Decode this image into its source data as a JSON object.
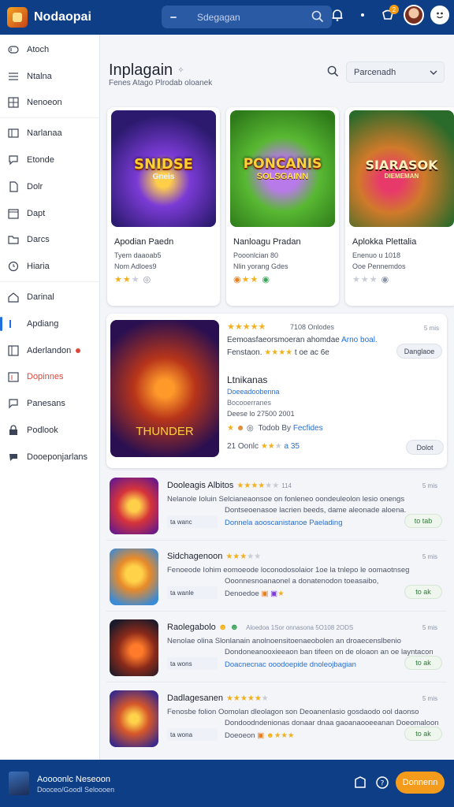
{
  "app": {
    "brand": "Nodaopai"
  },
  "search": {
    "placeholder": "Sdegagan"
  },
  "topbar": {
    "badge": "2"
  },
  "sidebar": {
    "items": [
      {
        "label": "Atoch",
        "icon": "toggle-icon"
      },
      {
        "label": "Ntalna",
        "icon": "menu-icon"
      },
      {
        "label": "Nenoeon",
        "icon": "grid-icon"
      },
      {
        "label": "Narlanaa",
        "icon": "box-icon"
      },
      {
        "label": "Etonde",
        "icon": "chat-icon"
      },
      {
        "label": "Dolr",
        "icon": "document-icon"
      },
      {
        "label": "Dapt",
        "icon": "calendar-icon"
      },
      {
        "label": "Darcs",
        "icon": "folder-icon"
      },
      {
        "label": "Hiaria",
        "icon": "clock-icon"
      },
      {
        "label": "Darinal",
        "icon": "home-icon"
      },
      {
        "label": "Apdiang",
        "icon": "bar-icon"
      },
      {
        "label": "Aderlandon",
        "icon": "grid-icon"
      },
      {
        "label": "Dopinnes",
        "icon": "calendar-icon"
      },
      {
        "label": "Panesans",
        "icon": "chat-icon"
      },
      {
        "label": "Podlook",
        "icon": "lock-icon"
      },
      {
        "label": "Dooeponjarlans",
        "icon": "speech-icon"
      }
    ]
  },
  "page": {
    "title": "Inplagain",
    "subtitle": "Fenes Atago Plrodab oloanek",
    "filter_label": "Parcenadh"
  },
  "cards": [
    {
      "art_text": "SNIDSE",
      "art_sub": "Gneis",
      "name": "Apodian Paedn",
      "meta1": "Tyem daaoab5",
      "meta2": "Nom Adloes9",
      "stars": 2
    },
    {
      "art_text": "PONCANIS",
      "art_sub": "SOLSGAINN",
      "name": "Nanloagu Pradan",
      "meta1": "Pooonlcian 80",
      "meta2": "Nlin yorang  Gdes",
      "stars": 3
    },
    {
      "art_text": "SIARASOK",
      "art_sub": "DIEMEMAN",
      "name": "Aplokka Plettalia",
      "meta1": "Enenuo u 1018",
      "meta2": "Ooe Pennemdos",
      "stars": 0
    }
  ],
  "featured": {
    "art_text": "THUNDER",
    "reviews": "7108 Onlodes",
    "size": "5 mis",
    "line1_text": "Eemoasfaeorsmoeran ahomdae",
    "line1_link": "Arno boal.",
    "line2_text": "Fenstaon.",
    "line2_tail": "t oe ac 6e",
    "pill1": "Danglaoe",
    "title": "Ltnikanas",
    "meta1": "Doeeadoobenna",
    "meta2": "Bocooerranes",
    "meta3": "Deese lo 27500 2001",
    "meta4_link": "Fecfides",
    "meta4_text": "Todob By",
    "meta5": "21  Oonlc",
    "meta5_link": "a 35",
    "pill2": "Dolot"
  },
  "rows": [
    {
      "name": "Dooleagis Albitos",
      "size": "5 mis",
      "stars": 4,
      "count": "114",
      "line1": "Nelanole Ioluin   Selcianeaonsoe on fonleneo oondeuleolon lesio onengs",
      "line2": "Dontseoenasoe lacrien beeds, dame aleonade aloena.",
      "line3": "Donnela aooscanistanoe Paelading",
      "tag": "ta wanc",
      "button": "to tab"
    },
    {
      "name": "Sidchagenoon",
      "size": "5 mis",
      "stars": 3,
      "count": "",
      "line1": "Fenoeode Iohim   eomoeode loconodosolaior 1oe la tnlepo le oomaotnseg",
      "line2": "Ooonnesnoanaonel a donatenodon toeasaibo,",
      "line3": "Denoedoe",
      "tag": "ta wanle",
      "button": "to ak"
    },
    {
      "name": "Raolegabolo",
      "size": "5 mis",
      "stars": 0,
      "count": "Aloedoa 1Sor onnasona 5O108 2ODS",
      "line1": "Nenolae olina   Slonlanain anolnoensitoenaeobolen an droaecenslbenio",
      "line2": "Dondoneanooxieeaon ban tifeen on de oloaon an oe layntacon",
      "line3": "Doacnecnac ooodoepide dnoleojbagian",
      "tag": "ta wons",
      "button": "to ak"
    },
    {
      "name": "Dadlagesanen",
      "size": "5 mis",
      "stars": 5,
      "count": "",
      "line1": "Fenosbe folion   Oomolan dleolagon son Deoanenlasio gosdaodo ool daonso",
      "line2": "Dondoodndenionas donaar dnaa gaoanaooeeanan Doeomaloon",
      "line3": "Doeoeon",
      "tag": "ta wona",
      "button": "to ak"
    }
  ],
  "bottom": {
    "title": "Aoooonlc Neseoon",
    "subtitle": "Dooceo/Goodl Seloooen",
    "cta": "Donnenn"
  },
  "colors": {
    "primary": "#0e3f86",
    "accent": "#f59b1c",
    "star": "#f2b01e",
    "link": "#2a6fd1"
  }
}
